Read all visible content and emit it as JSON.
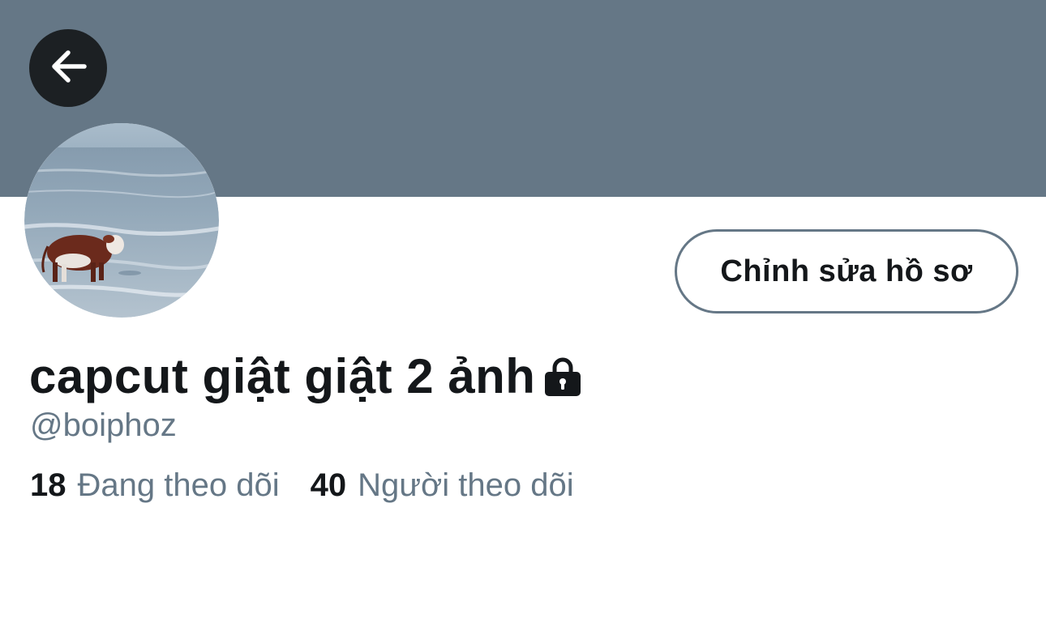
{
  "header": {
    "back_icon": "arrow-left-icon",
    "banner_color": "#657786"
  },
  "profile": {
    "avatar_description": "cow-standing-in-sea-avatar",
    "edit_button_label": "Chỉnh sửa hồ sơ",
    "display_name": "capcut giật giật 2 ảnh",
    "protected_icon": "lock-icon",
    "handle": "@boiphoz"
  },
  "stats": {
    "following_count": "18",
    "following_label": "Đang theo dõi",
    "followers_count": "40",
    "followers_label": "Người theo dõi"
  },
  "colors": {
    "primary_text": "#14171a",
    "secondary_text": "#657786",
    "background": "#ffffff"
  }
}
